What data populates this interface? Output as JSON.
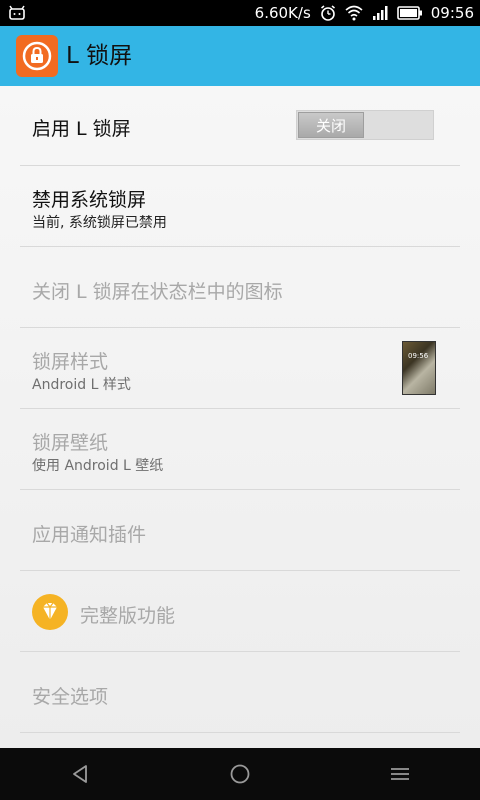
{
  "status_bar": {
    "net_speed": "6.60K/s",
    "time": "09:56",
    "icons": [
      "android-notify-icon",
      "alarm-icon",
      "wifi-icon",
      "signal-icon",
      "battery-icon"
    ]
  },
  "app_bar": {
    "title": "L 锁屏",
    "accent_color": "#33b5e5",
    "logo_color": "#f26b21"
  },
  "settings": {
    "enable": {
      "title": "启用 L 锁屏",
      "toggle_label": "关闭",
      "toggle_on": false
    },
    "disable_system": {
      "title": "禁用系统锁屏",
      "subtitle": "当前, 系统锁屏已禁用"
    },
    "statusbar_icon": {
      "title": "关闭 L 锁屏在状态栏中的图标"
    },
    "style": {
      "title": "锁屏样式",
      "subtitle": "Android L 样式",
      "preview_time": "09:56"
    },
    "wallpaper": {
      "title": "锁屏壁纸",
      "subtitle": "使用 Android L 壁纸"
    },
    "notify_plugin": {
      "title": "应用通知插件"
    },
    "full_version": {
      "title": "完整版功能"
    },
    "security": {
      "title": "安全选项"
    }
  },
  "nav_bar": {
    "icons": [
      "back-icon",
      "home-icon",
      "menu-icon"
    ]
  }
}
